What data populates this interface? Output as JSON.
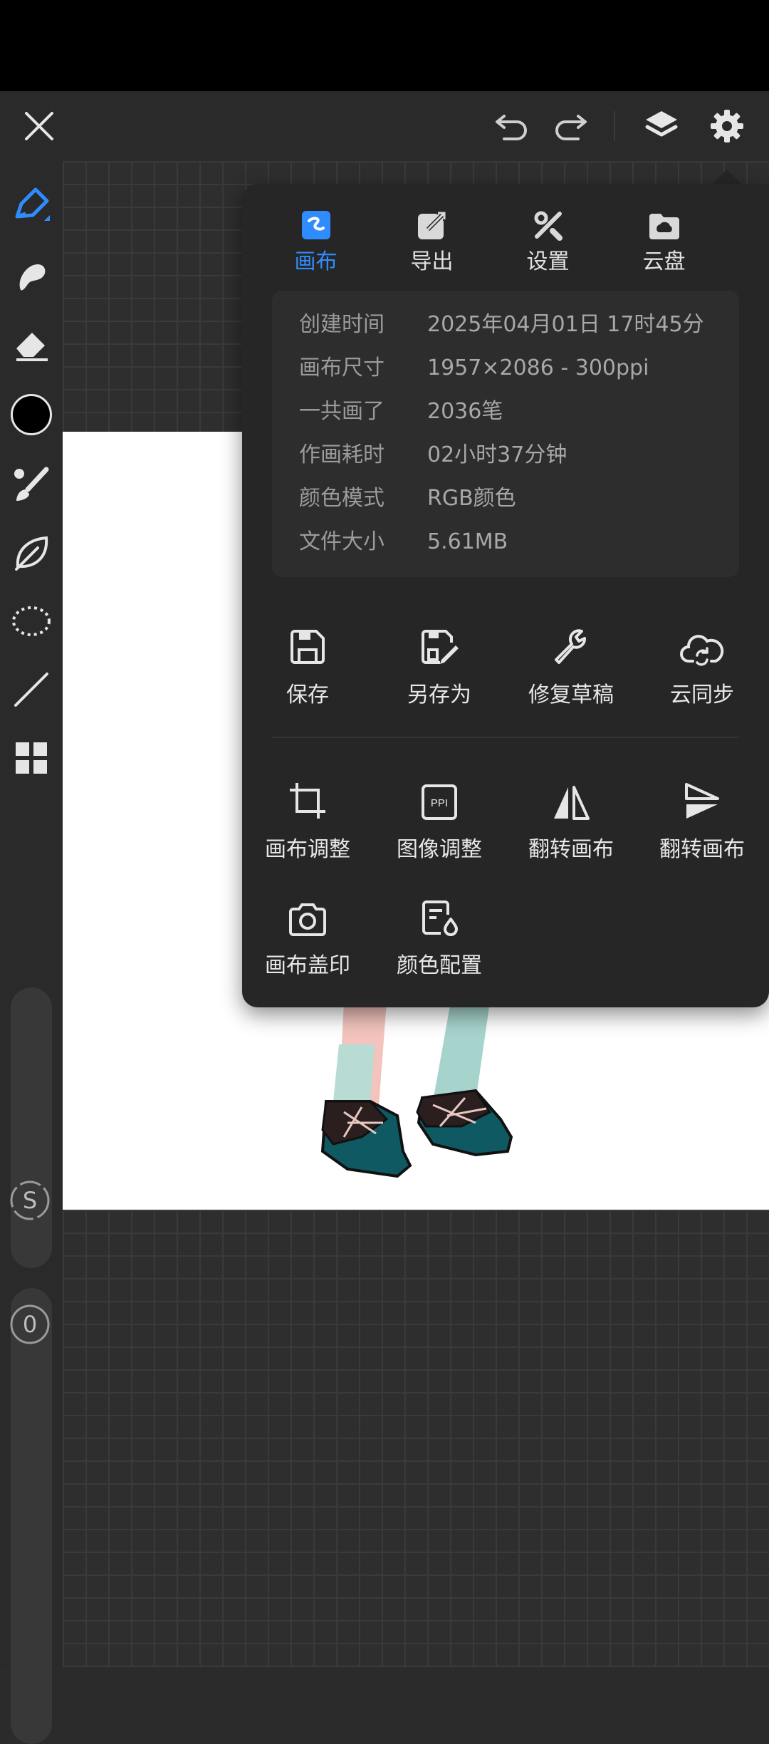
{
  "header": {
    "close_icon": "close-icon",
    "undo_icon": "undo-icon",
    "redo_icon": "redo-icon",
    "layers_icon": "layers-icon",
    "settings_icon": "gear-icon"
  },
  "toolbar": {
    "tools": [
      "pen-icon",
      "smudge-icon",
      "eraser-icon",
      "color-swatch",
      "brush-icon",
      "leaf-icon",
      "lasso-icon",
      "line-icon",
      "grid-icon"
    ],
    "color": "#000000",
    "size_slider_label": "S",
    "opacity_slider_label": "0"
  },
  "panel": {
    "tabs": [
      {
        "label": "画布",
        "icon": "canvas-icon",
        "active": true
      },
      {
        "label": "导出",
        "icon": "export-icon",
        "active": false
      },
      {
        "label": "设置",
        "icon": "settings-tools-icon",
        "active": false
      },
      {
        "label": "云盘",
        "icon": "cloud-drive-icon",
        "active": false
      }
    ],
    "info": [
      {
        "key": "创建时间",
        "value": "2025年04月01日 17时45分"
      },
      {
        "key": "画布尺寸",
        "value": "1957×2086 - 300ppi"
      },
      {
        "key": "一共画了",
        "value": "2036笔"
      },
      {
        "key": "作画耗时",
        "value": "02小时37分钟"
      },
      {
        "key": "颜色模式",
        "value": "RGB颜色"
      },
      {
        "key": "文件大小",
        "value": "5.61MB"
      }
    ],
    "actions_row1": [
      {
        "label": "保存",
        "icon": "save-icon"
      },
      {
        "label": "另存为",
        "icon": "save-as-icon"
      },
      {
        "label": "修复草稿",
        "icon": "wrench-icon"
      },
      {
        "label": "云同步",
        "icon": "cloud-sync-icon"
      }
    ],
    "actions_row2": [
      {
        "label": "画布调整",
        "icon": "crop-icon"
      },
      {
        "label": "图像调整",
        "icon": "ppi-icon"
      },
      {
        "label": "翻转画布",
        "icon": "flip-horizontal-icon"
      },
      {
        "label": "翻转画布",
        "icon": "flip-vertical-icon"
      }
    ],
    "actions_row3": [
      {
        "label": "画布盖印",
        "icon": "camera-icon"
      },
      {
        "label": "颜色配置",
        "icon": "color-profile-icon"
      }
    ]
  },
  "colors": {
    "accent": "#2f8cff",
    "panel_bg": "#262626",
    "toolbar_bg": "#2a2a2a"
  }
}
